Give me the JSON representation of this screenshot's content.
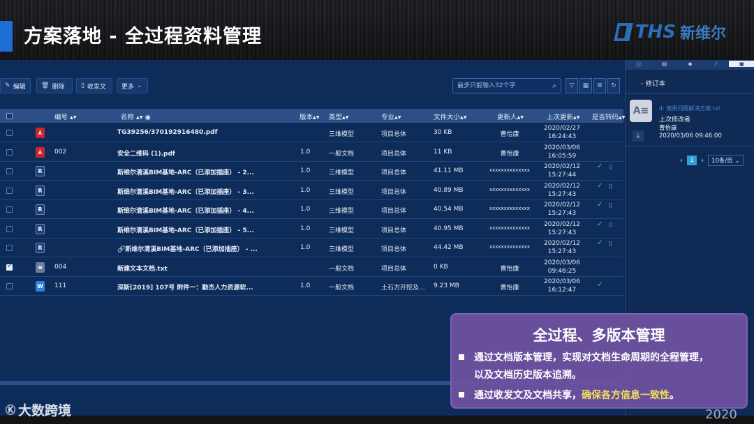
{
  "slide": {
    "title": "方案落地 - 全过程资料管理",
    "logo_text": "THS",
    "logo_cn": "新维尔"
  },
  "toolbar": {
    "edit": "编辑",
    "delete": "删除",
    "send_receive": "收发文",
    "more": "更多",
    "search_placeholder": "最多只能输入32个字"
  },
  "table": {
    "columns": [
      "编号",
      "名称",
      "版本",
      "类型",
      "专业",
      "文件大小",
      "更新人",
      "上次更新",
      "是否转码"
    ],
    "rows": [
      {
        "id": "",
        "icon": "pdf",
        "name": "TG39256/370192916480.pdf",
        "version": "",
        "type": "三维模型",
        "discipline": "项目总体",
        "size": "30 KB",
        "updater": "曹怡康",
        "date": "2020/02/27",
        "time": "16:24:43",
        "converted": false,
        "checked": false
      },
      {
        "id": "002",
        "icon": "pdf",
        "name": "安全二维码 (1).pdf",
        "version": "1.0",
        "type": "一般文档",
        "discipline": "项目总体",
        "size": "11 KB",
        "updater": "曹怡康",
        "date": "2020/03/06",
        "time": "16:05:59",
        "converted": false,
        "checked": false
      },
      {
        "id": "",
        "icon": "rvt",
        "name": "斯维尔清溪BIM基地-ARC（已添加插座） - 2...",
        "version": "1.0",
        "type": "三维模型",
        "discipline": "项目总体",
        "size": "41.11 MB",
        "updater": "xxxxxxxxxxxxxx",
        "date": "2020/02/12",
        "time": "15:27:44",
        "converted": true,
        "checked": false
      },
      {
        "id": "",
        "icon": "rvt",
        "name": "斯维尔清溪BIM基地-ARC（已添加插座） - 3...",
        "version": "1.0",
        "type": "三维模型",
        "discipline": "项目总体",
        "size": "40.89 MB",
        "updater": "xxxxxxxxxxxxxx",
        "date": "2020/02/12",
        "time": "15:27:43",
        "converted": true,
        "checked": false
      },
      {
        "id": "",
        "icon": "rvt",
        "name": "斯维尔清溪BIM基地-ARC（已添加插座） - 4...",
        "version": "1.0",
        "type": "三维模型",
        "discipline": "项目总体",
        "size": "40.54 MB",
        "updater": "xxxxxxxxxxxxxx",
        "date": "2020/02/12",
        "time": "15:27:43",
        "converted": true,
        "checked": false
      },
      {
        "id": "",
        "icon": "rvt",
        "name": "斯维尔清溪BIM基地-ARC（已添加插座） - 5...",
        "version": "1.0",
        "type": "三维模型",
        "discipline": "项目总体",
        "size": "40.95 MB",
        "updater": "xxxxxxxxxxxxxx",
        "date": "2020/02/12",
        "time": "15:27:43",
        "converted": true,
        "checked": false
      },
      {
        "id": "",
        "icon": "rvt",
        "name": "🔗斯维尔清溪BIM基地-ARC（已添加插座） - ...",
        "version": "1.0",
        "type": "三维模型",
        "discipline": "项目总体",
        "size": "44.42 MB",
        "updater": "xxxxxxxxxxxxxx",
        "date": "2020/02/12",
        "time": "15:27:43",
        "converted": true,
        "checked": false
      },
      {
        "id": "004",
        "icon": "txt",
        "name": "新建文本文档.txt",
        "version": "",
        "type": "一般文档",
        "discipline": "项目总体",
        "size": "0 KB",
        "updater": "曹怡康",
        "date": "2020/03/06",
        "time": "09:46:25",
        "converted": false,
        "checked": true
      },
      {
        "id": "111",
        "icon": "doc",
        "name": "深斯[2019] 107号 附件一：勤杰人力资源软...",
        "version": "1.0",
        "type": "一般文档",
        "discipline": "土石方开挖及...",
        "size": "9.23 MB",
        "updater": "曹怡康",
        "date": "2020/03/06",
        "time": "16:12:47",
        "converted": true,
        "checked": false
      }
    ]
  },
  "side_panel": {
    "title": "- 修订本",
    "file_name": "4: 使用问题解决方案.txt",
    "modifier_label": "上次修改者",
    "modifier": "曹怡康",
    "modified_time": "2020/03/06 09:46:00",
    "page_current": "1",
    "page_size": "10条/页"
  },
  "callout": {
    "title": "全过程、多版本管理",
    "item1_line1": "通过文档版本管理，实现对文档生命周期的全程管理，",
    "item1_line2": "以及文档历史版本追溯。",
    "item2_text": "通过收发文及文档共享，",
    "item2_highlight": "确保各方信息一致性",
    "item2_end": "。"
  },
  "watermark": {
    "left": "大数跨境",
    "right": "2020"
  },
  "colors": {
    "accent": "#1d6fd6",
    "app_bg": "#0e2c5a",
    "header_bg": "#2b4f86",
    "callout_bg": "#6e52a0",
    "highlight": "#f3e05a",
    "ok": "#4dc28a"
  }
}
